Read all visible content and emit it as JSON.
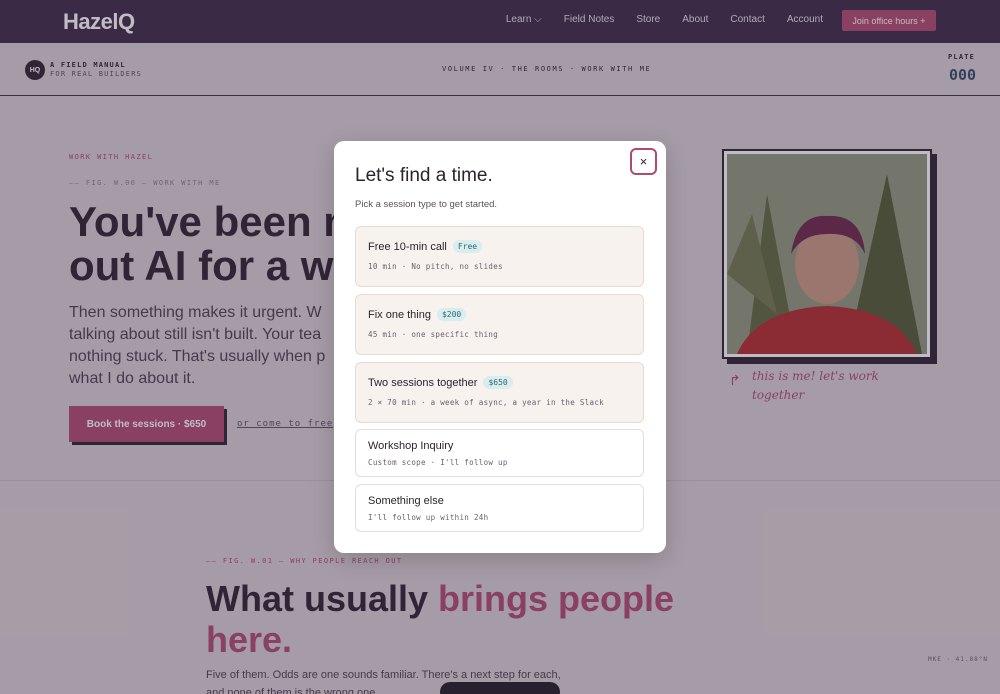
{
  "nav": {
    "logo": "HazelQ",
    "links": [
      "Learn ⌵",
      "Field Notes",
      "Store",
      "About",
      "Contact",
      "Account"
    ],
    "cta": "Join office hours +"
  },
  "subbar": {
    "badge": "HQ",
    "manual_line1": "A FIELD MANUAL",
    "manual_line2": "FOR REAL BUILDERS",
    "volume": "VOLUME IV · THE ROOMS · WORK WITH ME",
    "plate_label": "PLATE",
    "plate_number": "000"
  },
  "hero": {
    "eyebrow": "WORK WITH HAZEL",
    "fig": "—— FIG. W.00 — WORK WITH ME",
    "headline_line1": "You've been m",
    "headline_line2": "out AI for a wh",
    "lead_line1": "Then something makes it urgent. W",
    "lead_line2": "talking about still isn't built. Your tea",
    "lead_line3": "nothing stuck. That's usually when p",
    "lead_line4": "what I do about it.",
    "book_button": "Book the sessions · $650",
    "free_link": "or come to free o",
    "caption": "this is me! let's work together"
  },
  "section2": {
    "fig": "—— FIG. W.01 — WHY PEOPLE REACH OUT",
    "headline_a": "What usually ",
    "headline_b": "brings people here.",
    "para_line1": "Five of them. Odds are one sounds familiar. There's a next step for each,",
    "para_line2": "and none of them is the wrong one.",
    "coord": "MKE · 41.88°N"
  },
  "modal": {
    "close": "×",
    "title": "Let's find a time.",
    "subtitle": "Pick a session type to get started.",
    "options": [
      {
        "title": "Free 10-min call",
        "badge": "Free",
        "meta": "10 min · No pitch, no slides"
      },
      {
        "title": "Fix one thing",
        "badge": "$200",
        "meta": "45 min · one specific thing"
      },
      {
        "title": "Two sessions together",
        "badge": "$650",
        "meta": "2 × 70 min · a week of async, a year in the Slack"
      },
      {
        "title": "Workshop Inquiry",
        "badge": "",
        "meta": "Custom scope · I'll follow up"
      },
      {
        "title": "Something else",
        "badge": "",
        "meta": "I'll follow up within 24h"
      }
    ]
  },
  "colors": {
    "nav_bg": "#3a2a44",
    "accent": "#b04a6e",
    "badge_bg": "#d9ecee"
  }
}
